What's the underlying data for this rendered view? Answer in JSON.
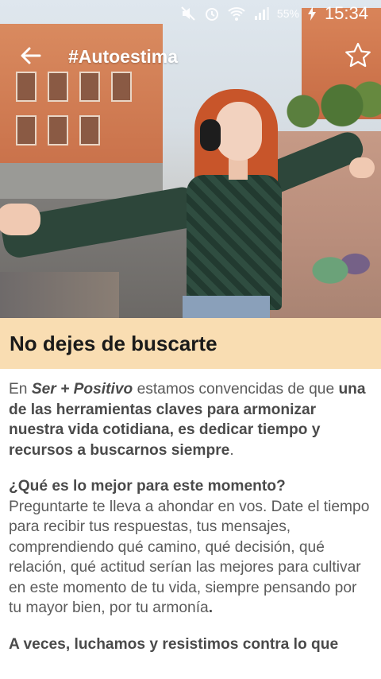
{
  "status_bar": {
    "icons": [
      "mute-icon",
      "alarm-icon",
      "wifi-icon",
      "signal-icon",
      "battery-charging-icon"
    ],
    "battery": "55%",
    "time": "15:34"
  },
  "toolbar": {
    "title": "#Autoestima"
  },
  "article": {
    "title": "No dejes de buscarte",
    "p1": {
      "s1": "En ",
      "brand": "Ser + Positivo",
      "s2": " estamos convencidas de que ",
      "bold": "una de las herramientas claves para armonizar nuestra vida cotidiana, es dedicar tiempo y recursos a buscarnos siempre",
      "end": "."
    },
    "p2": {
      "question": "¿Qué es lo mejor para este momento?",
      "text": "Preguntarte te lleva a ahondar en vos. Date el tiempo para recibir tus respuestas, tus mensajes, comprendiendo qué camino, qué decisión, qué relación, qué actitud serían las mejores para cultivar en este momento de tu vida, siempre pensando por tu mayor bien, por tu armonía",
      "end": "."
    },
    "p3": {
      "bold": "A veces, luchamos y resistimos contra lo que"
    }
  },
  "colors": {
    "heading_band": "#f9ddb2",
    "body_text": "#5b5b5b"
  }
}
